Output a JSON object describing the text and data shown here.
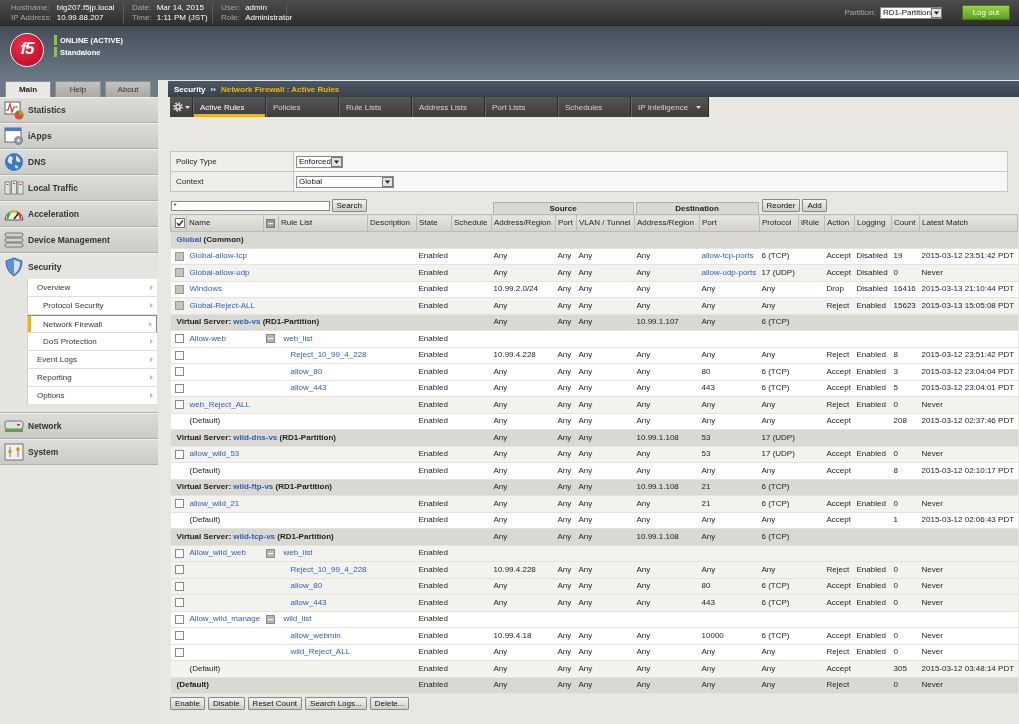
{
  "top_bar": {
    "info_groups": [
      {
        "rows": [
          {
            "label": "Hostname:",
            "value": "big207.f5jp.local"
          },
          {
            "label": "IP Address:",
            "value": "10.99.88.207"
          }
        ]
      },
      {
        "rows": [
          {
            "label": "Date:",
            "value": "Mar 14, 2015"
          },
          {
            "label": "Time:",
            "value": "1:11 PM (JST)"
          }
        ]
      },
      {
        "rows": [
          {
            "label": "User:",
            "value": "admin"
          },
          {
            "label": "Role:",
            "value": "Administrator"
          }
        ]
      }
    ],
    "partition": {
      "label": "Partition:",
      "value": "RD1-Partition"
    },
    "logout_button": "Log out"
  },
  "banner": {
    "logo": "f5",
    "status": [
      "ONLINE (ACTIVE)",
      "Standalone"
    ]
  },
  "sidebar": {
    "tabs": [
      {
        "label": "Main",
        "selected": true
      },
      {
        "label": "Help",
        "selected": false
      },
      {
        "label": "About",
        "selected": false
      }
    ],
    "items": [
      {
        "label": "Statistics",
        "kind": "chart",
        "expanded": false
      },
      {
        "label": "iApps",
        "kind": "window",
        "expanded": false
      },
      {
        "label": "DNS",
        "kind": "globe",
        "expanded": false
      },
      {
        "label": "Local Traffic",
        "kind": "servers",
        "expanded": false
      },
      {
        "label": "Acceleration",
        "kind": "gauge",
        "expanded": false
      },
      {
        "label": "Device Management",
        "kind": "storage",
        "expanded": false
      },
      {
        "label": "Security",
        "kind": "shield",
        "expanded": true,
        "children": [
          {
            "label": "Overview",
            "selected": false,
            "children": [
              {
                "label": "Protocol Security",
                "selected": false
              },
              {
                "label": "Network Firewall",
                "selected": true
              },
              {
                "label": "DoS Protection",
                "selected": false
              }
            ]
          },
          {
            "label": "Event Logs",
            "selected": false
          },
          {
            "label": "Reporting",
            "selected": false
          },
          {
            "label": "Options",
            "selected": false
          }
        ]
      },
      {
        "label": "Network",
        "kind": "router",
        "expanded": false
      },
      {
        "label": "System",
        "kind": "panel",
        "expanded": false
      }
    ]
  },
  "breadcrumb": {
    "section": "Security",
    "separator": "››",
    "page": "Network Firewall : Active Rules"
  },
  "tabs": [
    {
      "label": "Active Rules",
      "selected": true
    },
    {
      "label": "Policies",
      "selected": false
    },
    {
      "label": "Rule Lists",
      "selected": false
    },
    {
      "label": "Address Lists",
      "selected": false
    },
    {
      "label": "Port Lists",
      "selected": false
    },
    {
      "label": "Schedules",
      "selected": false
    },
    {
      "label": "IP Intelligence",
      "selected": false,
      "has_menu": true
    }
  ],
  "filters": [
    {
      "label": "Policy Type",
      "value": "Enforced"
    },
    {
      "label": "Context",
      "value": "Global"
    }
  ],
  "rules_table": {
    "search": {
      "value": "*",
      "button": "Search"
    },
    "buttons": [
      "Reorder",
      "Add"
    ],
    "column_groups": [
      "Source",
      "Destination"
    ],
    "columns": [
      "Name",
      "Rule List",
      "Description",
      "State",
      "Schedule",
      "Address/Region",
      "Port",
      "VLAN / Tunnel",
      "Address/Region",
      "Port",
      "Protocol",
      "iRule",
      "Action",
      "Logging",
      "Count",
      "Latest Match"
    ],
    "sections": [
      {
        "kind": "context",
        "name": "Global",
        "suffix": "(Common)",
        "rows": [
          {
            "kind": "rule",
            "checked": false,
            "disabled": true,
            "name": "Global-allow-tcp",
            "state": "Enabled",
            "src_address": "Any",
            "src_port": "Any",
            "vlan": "Any",
            "dst_address": "Any",
            "dst_port": "allow-tcp-ports",
            "dst_port_link": true,
            "protocol": "6 (TCP)",
            "action": "Accept",
            "logging": "Disabled",
            "count": "19",
            "latest_match": "2015-03-12 23:51:42 PDT"
          },
          {
            "kind": "rule",
            "checked": false,
            "disabled": true,
            "name": "Global-allow-udp",
            "state": "Enabled",
            "src_address": "Any",
            "src_port": "Any",
            "vlan": "Any",
            "dst_address": "Any",
            "dst_port": "allow-udp-ports",
            "dst_port_link": true,
            "protocol": "17 (UDP)",
            "action": "Accept",
            "logging": "Disabled",
            "count": "0",
            "latest_match": "Never"
          },
          {
            "kind": "rule",
            "checked": false,
            "disabled": true,
            "name": "Windows",
            "state": "Enabled",
            "src_address": "10.99.2.0/24",
            "src_port": "Any",
            "vlan": "Any",
            "dst_address": "Any",
            "dst_port": "Any",
            "protocol": "Any",
            "action": "Drop",
            "logging": "Disabled",
            "count": "16416",
            "latest_match": "2015-03-13 21:10:44 PDT"
          },
          {
            "kind": "rule",
            "checked": false,
            "disabled": true,
            "name": "Global-Reject-ALL",
            "state": "Enabled",
            "src_address": "Any",
            "src_port": "Any",
            "vlan": "Any",
            "dst_address": "Any",
            "dst_port": "Any",
            "protocol": "Any",
            "action": "Reject",
            "logging": "Enabled",
            "count": "15623",
            "latest_match": "2015-03-13 15:05:08 PDT"
          }
        ]
      },
      {
        "kind": "virtual_server",
        "prefix": "Virtual Server:",
        "name": "web-vs",
        "suffix": "(RD1-Partition)",
        "src_address": "Any",
        "src_port": "Any",
        "vlan": "Any",
        "dst_address": "10.99.1.107",
        "dst_port": "Any",
        "protocol": "6 (TCP)",
        "rows": [
          {
            "kind": "rule_list",
            "checked": false,
            "disabled": false,
            "expanded": true,
            "name": "Allow-web",
            "rule_list": "web_list",
            "state": "Enabled",
            "children": [
              {
                "kind": "rule",
                "checked": false,
                "disabled": false,
                "name": "Reject_10_99_4_228",
                "state": "Enabled",
                "src_address": "10.99.4.228",
                "src_port": "Any",
                "vlan": "Any",
                "dst_address": "Any",
                "dst_port": "Any",
                "protocol": "Any",
                "action": "Reject",
                "logging": "Enabled",
                "count": "8",
                "latest_match": "2015-03-12 23:51:42 PDT"
              },
              {
                "kind": "rule",
                "checked": false,
                "disabled": false,
                "name": "allow_80",
                "state": "Enabled",
                "src_address": "Any",
                "src_port": "Any",
                "vlan": "Any",
                "dst_address": "Any",
                "dst_port": "80",
                "protocol": "6 (TCP)",
                "action": "Accept",
                "logging": "Enabled",
                "count": "3",
                "latest_match": "2015-03-12 23:04:04 PDT"
              },
              {
                "kind": "rule",
                "checked": false,
                "disabled": false,
                "name": "allow_443",
                "state": "Enabled",
                "src_address": "Any",
                "src_port": "Any",
                "vlan": "Any",
                "dst_address": "Any",
                "dst_port": "443",
                "protocol": "6 (TCP)",
                "action": "Accept",
                "logging": "Enabled",
                "count": "5",
                "latest_match": "2015-03-12 23:04:01 PDT"
              }
            ]
          },
          {
            "kind": "rule",
            "checked": false,
            "disabled": false,
            "name": "web_Reject_ALL",
            "state": "Enabled",
            "src_address": "Any",
            "src_port": "Any",
            "vlan": "Any",
            "dst_address": "Any",
            "dst_port": "Any",
            "protocol": "Any",
            "action": "Reject",
            "logging": "Enabled",
            "count": "0",
            "latest_match": "Never"
          },
          {
            "kind": "default",
            "name": "(Default)",
            "state": "Enabled",
            "src_address": "Any",
            "src_port": "Any",
            "vlan": "Any",
            "dst_address": "Any",
            "dst_port": "Any",
            "protocol": "Any",
            "action": "Accept",
            "count": "208",
            "latest_match": "2015-03-12 02:37:46 PDT"
          }
        ]
      },
      {
        "kind": "virtual_server",
        "prefix": "Virtual Server:",
        "name": "wild-dns-vs",
        "suffix": "(RD1-Partition)",
        "src_address": "Any",
        "src_port": "Any",
        "vlan": "Any",
        "dst_address": "10.99.1.108",
        "dst_port": "53",
        "protocol": "17 (UDP)",
        "rows": [
          {
            "kind": "rule",
            "checked": false,
            "disabled": false,
            "name": "allow_wild_53",
            "state": "Enabled",
            "src_address": "Any",
            "src_port": "Any",
            "vlan": "Any",
            "dst_address": "Any",
            "dst_port": "53",
            "protocol": "17 (UDP)",
            "action": "Accept",
            "logging": "Enabled",
            "count": "0",
            "latest_match": "Never"
          },
          {
            "kind": "default",
            "name": "(Default)",
            "state": "Enabled",
            "src_address": "Any",
            "src_port": "Any",
            "vlan": "Any",
            "dst_address": "Any",
            "dst_port": "Any",
            "protocol": "Any",
            "action": "Accept",
            "count": "8",
            "latest_match": "2015-03-12 02:10:17 PDT"
          }
        ]
      },
      {
        "kind": "virtual_server",
        "prefix": "Virtual Server:",
        "name": "wild-ftp-vs",
        "suffix": "(RD1-Partition)",
        "src_address": "Any",
        "src_port": "Any",
        "vlan": "Any",
        "dst_address": "10.99.1.108",
        "dst_port": "21",
        "protocol": "6 (TCP)",
        "rows": [
          {
            "kind": "rule",
            "checked": false,
            "disabled": false,
            "name": "allow_wild_21",
            "state": "Enabled",
            "src_address": "Any",
            "src_port": "Any",
            "vlan": "Any",
            "dst_address": "Any",
            "dst_port": "21",
            "protocol": "6 (TCP)",
            "action": "Accept",
            "logging": "Enabled",
            "count": "0",
            "latest_match": "Never"
          },
          {
            "kind": "default",
            "name": "(Default)",
            "state": "Enabled",
            "src_address": "Any",
            "src_port": "Any",
            "vlan": "Any",
            "dst_address": "Any",
            "dst_port": "Any",
            "protocol": "Any",
            "action": "Accept",
            "count": "1",
            "latest_match": "2015-03-12 02:06:43 PDT"
          }
        ]
      },
      {
        "kind": "virtual_server",
        "prefix": "Virtual Server:",
        "name": "wild-tcp-vs",
        "suffix": "(RD1-Partition)",
        "src_address": "Any",
        "src_port": "Any",
        "vlan": "Any",
        "dst_address": "10.99.1.108",
        "dst_port": "Any",
        "protocol": "6 (TCP)",
        "rows": [
          {
            "kind": "rule_list",
            "checked": false,
            "disabled": false,
            "expanded": true,
            "name": "Allow_wild_web",
            "rule_list": "web_list",
            "state": "Enabled",
            "children": [
              {
                "kind": "rule",
                "checked": false,
                "disabled": false,
                "name": "Reject_10_99_4_228",
                "state": "Enabled",
                "src_address": "10.99.4.228",
                "src_port": "Any",
                "vlan": "Any",
                "dst_address": "Any",
                "dst_port": "Any",
                "protocol": "Any",
                "action": "Reject",
                "logging": "Enabled",
                "count": "0",
                "latest_match": "Never"
              },
              {
                "kind": "rule",
                "checked": false,
                "disabled": false,
                "name": "allow_80",
                "state": "Enabled",
                "src_address": "Any",
                "src_port": "Any",
                "vlan": "Any",
                "dst_address": "Any",
                "dst_port": "80",
                "protocol": "6 (TCP)",
                "action": "Accept",
                "logging": "Enabled",
                "count": "0",
                "latest_match": "Never"
              },
              {
                "kind": "rule",
                "checked": false,
                "disabled": false,
                "name": "allow_443",
                "state": "Enabled",
                "src_address": "Any",
                "src_port": "Any",
                "vlan": "Any",
                "dst_address": "Any",
                "dst_port": "443",
                "protocol": "6 (TCP)",
                "action": "Accept",
                "logging": "Enabled",
                "count": "0",
                "latest_match": "Never"
              }
            ]
          },
          {
            "kind": "rule_list",
            "checked": false,
            "disabled": false,
            "expanded": true,
            "name": "Allow_wild_manage",
            "rule_list": "wild_list",
            "state": "Enabled",
            "children": [
              {
                "kind": "rule",
                "checked": false,
                "disabled": false,
                "name": "allow_webmin",
                "state": "Enabled",
                "src_address": "10.99.4.18",
                "src_port": "Any",
                "vlan": "Any",
                "dst_address": "Any",
                "dst_port": "10000",
                "protocol": "6 (TCP)",
                "action": "Accept",
                "logging": "Enabled",
                "count": "0",
                "latest_match": "Never"
              },
              {
                "kind": "rule",
                "checked": false,
                "disabled": false,
                "name": "wild_Reject_ALL",
                "state": "Enabled",
                "src_address": "Any",
                "src_port": "Any",
                "vlan": "Any",
                "dst_address": "Any",
                "dst_port": "Any",
                "protocol": "Any",
                "action": "Reject",
                "logging": "Enabled",
                "count": "0",
                "latest_match": "Never"
              }
            ]
          },
          {
            "kind": "default",
            "name": "(Default)",
            "state": "Enabled",
            "src_address": "Any",
            "src_port": "Any",
            "vlan": "Any",
            "dst_address": "Any",
            "dst_port": "Any",
            "protocol": "Any",
            "action": "Accept",
            "count": "305",
            "latest_match": "2015-03-12 03:48:14 PDT"
          }
        ]
      },
      {
        "kind": "default",
        "name": "(Default)",
        "state": "Enabled",
        "src_address": "Any",
        "src_port": "Any",
        "vlan": "Any",
        "dst_address": "Any",
        "dst_port": "Any",
        "protocol": "Any",
        "action": "Reject",
        "count": "0",
        "latest_match": "Never"
      }
    ]
  },
  "bottom_buttons": [
    "Enable",
    "Disable",
    "Reset Count",
    "Search Logs...",
    "Delete..."
  ]
}
